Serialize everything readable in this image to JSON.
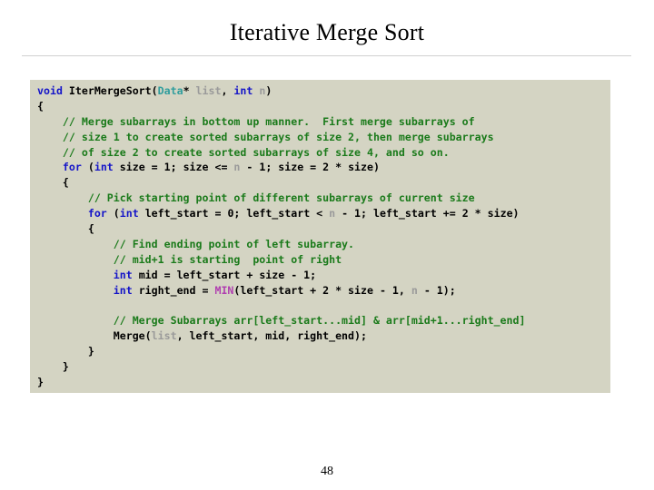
{
  "slide": {
    "title": "Iterative Merge Sort",
    "page_number": "48",
    "colors": {
      "code_background": "#d4d4c3",
      "keyword": "#1414c8",
      "type": "#2f9d9d",
      "variable": "#9a9a9a",
      "comment": "#1a7a1a",
      "macro": "#b03fb0",
      "plain": "#000000",
      "rule": "#d0d0d0",
      "slide_background": "#ffffff"
    }
  },
  "code": {
    "language": "c",
    "lines": [
      [
        {
          "t": "void",
          "c": "kw"
        },
        {
          "t": " ",
          "c": "plain"
        },
        {
          "t": "IterMergeSort",
          "c": "plain"
        },
        {
          "t": "(",
          "c": "plain"
        },
        {
          "t": "Data",
          "c": "type"
        },
        {
          "t": "* ",
          "c": "plain"
        },
        {
          "t": "list",
          "c": "var"
        },
        {
          "t": ", ",
          "c": "plain"
        },
        {
          "t": "int",
          "c": "kw"
        },
        {
          "t": " ",
          "c": "plain"
        },
        {
          "t": "n",
          "c": "var"
        },
        {
          "t": ")",
          "c": "plain"
        }
      ],
      [
        {
          "t": "{",
          "c": "plain"
        }
      ],
      [
        {
          "t": "    ",
          "c": "plain"
        },
        {
          "t": "// Merge subarrays in bottom up manner.  First merge subarrays of",
          "c": "comment"
        }
      ],
      [
        {
          "t": "    ",
          "c": "plain"
        },
        {
          "t": "// size 1 to create sorted subarrays of size 2, then merge subarrays",
          "c": "comment"
        }
      ],
      [
        {
          "t": "    ",
          "c": "plain"
        },
        {
          "t": "// of size 2 to create sorted subarrays of size 4, and so on.",
          "c": "comment"
        }
      ],
      [
        {
          "t": "    ",
          "c": "plain"
        },
        {
          "t": "for",
          "c": "kw"
        },
        {
          "t": " (",
          "c": "plain"
        },
        {
          "t": "int",
          "c": "kw"
        },
        {
          "t": " size = 1; size <= ",
          "c": "plain"
        },
        {
          "t": "n",
          "c": "var"
        },
        {
          "t": " - 1; size = 2 * size)",
          "c": "plain"
        }
      ],
      [
        {
          "t": "    {",
          "c": "plain"
        }
      ],
      [
        {
          "t": "        ",
          "c": "plain"
        },
        {
          "t": "// Pick starting point of different subarrays of current size",
          "c": "comment"
        }
      ],
      [
        {
          "t": "        ",
          "c": "plain"
        },
        {
          "t": "for",
          "c": "kw"
        },
        {
          "t": " (",
          "c": "plain"
        },
        {
          "t": "int",
          "c": "kw"
        },
        {
          "t": " left_start = 0; left_start < ",
          "c": "plain"
        },
        {
          "t": "n",
          "c": "var"
        },
        {
          "t": " - 1; left_start += 2 * size)",
          "c": "plain"
        }
      ],
      [
        {
          "t": "        {",
          "c": "plain"
        }
      ],
      [
        {
          "t": "            ",
          "c": "plain"
        },
        {
          "t": "// Find ending point of left subarray.",
          "c": "comment"
        }
      ],
      [
        {
          "t": "            ",
          "c": "plain"
        },
        {
          "t": "// mid+1 is starting  point of right",
          "c": "comment"
        }
      ],
      [
        {
          "t": "            ",
          "c": "plain"
        },
        {
          "t": "int",
          "c": "kw"
        },
        {
          "t": " mid = left_start + size - 1;",
          "c": "plain"
        }
      ],
      [
        {
          "t": "            ",
          "c": "plain"
        },
        {
          "t": "int",
          "c": "kw"
        },
        {
          "t": " right_end = ",
          "c": "plain"
        },
        {
          "t": "MIN",
          "c": "macro"
        },
        {
          "t": "(left_start + 2 * size - 1, ",
          "c": "plain"
        },
        {
          "t": "n",
          "c": "var"
        },
        {
          "t": " - 1);",
          "c": "plain"
        }
      ],
      [
        {
          "t": "",
          "c": "plain"
        }
      ],
      [
        {
          "t": "            ",
          "c": "plain"
        },
        {
          "t": "// Merge Subarrays arr[left_start...mid] & arr[mid+1...right_end]",
          "c": "comment"
        }
      ],
      [
        {
          "t": "            ",
          "c": "plain"
        },
        {
          "t": "Merge(",
          "c": "plain"
        },
        {
          "t": "list",
          "c": "var"
        },
        {
          "t": ", left_start, mid, right_end);",
          "c": "plain"
        }
      ],
      [
        {
          "t": "        }",
          "c": "plain"
        }
      ],
      [
        {
          "t": "    }",
          "c": "plain"
        }
      ],
      [
        {
          "t": "}",
          "c": "plain"
        }
      ]
    ]
  }
}
